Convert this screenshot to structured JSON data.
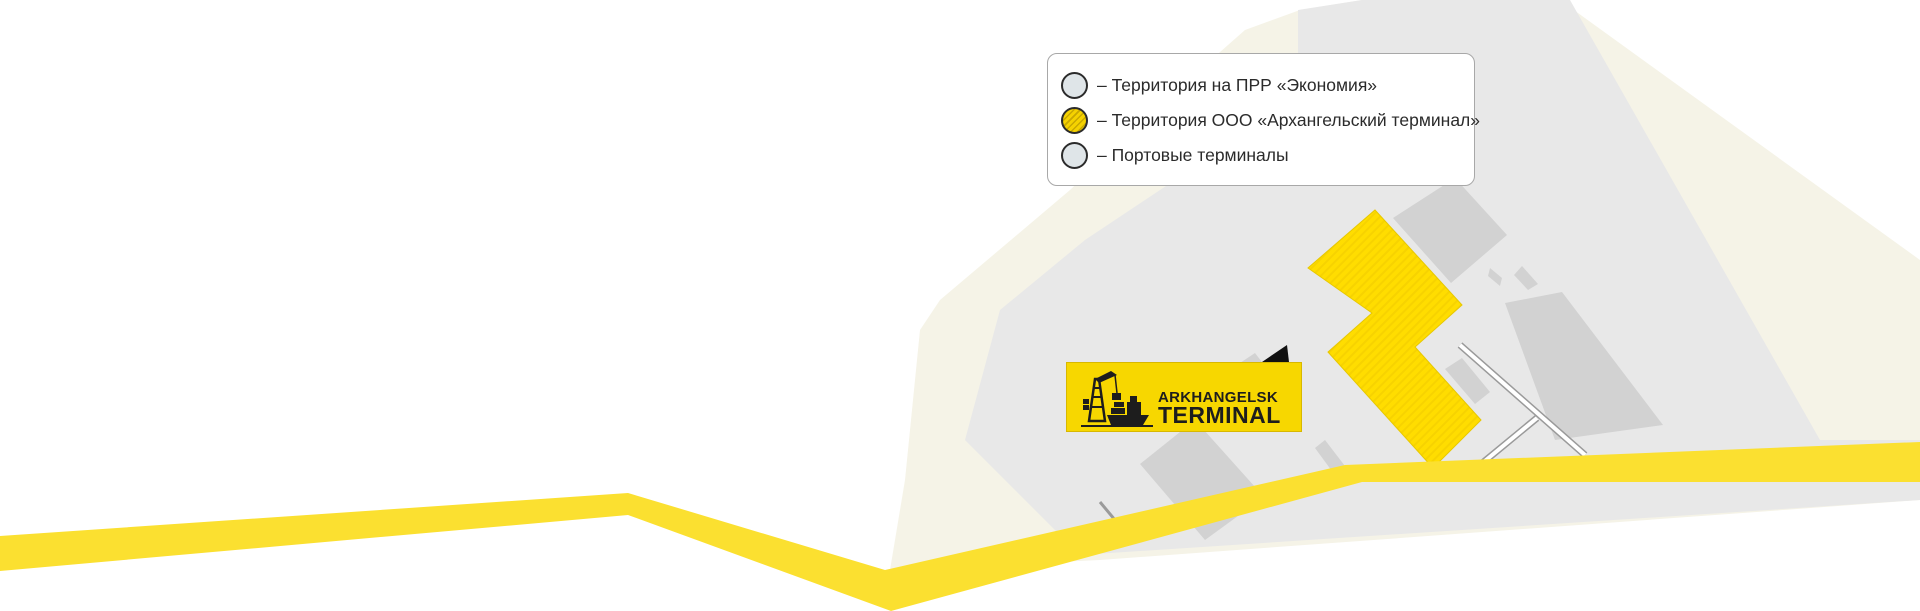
{
  "legend": {
    "items": [
      {
        "label": "– Территория на ПРР «Экономия»",
        "swatch": "grey",
        "color": "#dfe5e8"
      },
      {
        "label": "– Территория ООО «Архангельский терминал»",
        "swatch": "hatched-yellow",
        "color": "#f5d200"
      },
      {
        "label": "– Портовые терминалы",
        "swatch": "grey",
        "color": "#dfe5e8"
      }
    ]
  },
  "logo": {
    "line1": "ARKHANGELSK",
    "line2": "TERMINAL",
    "icon": "crane-ship-icon",
    "background": "#f7d700"
  },
  "colors": {
    "road": "#fbe030",
    "territory": "#e8e8e8",
    "beach": "#f5f3e7",
    "building": "#d2d2d2",
    "terminal_area": "#ffdd00"
  }
}
